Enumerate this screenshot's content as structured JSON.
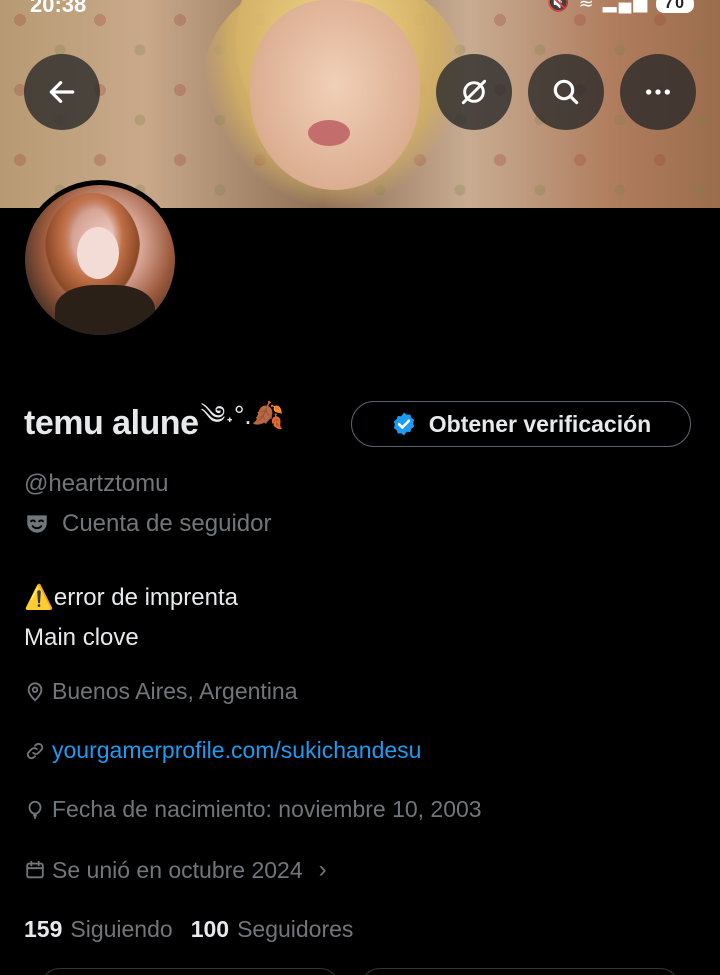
{
  "status_bar": {
    "time": "20:38",
    "battery": "70"
  },
  "header": {
    "buttons": [
      {
        "icon": "back-arrow-icon"
      },
      {
        "icon": "grok-icon"
      },
      {
        "icon": "search-icon"
      },
      {
        "icon": "more-icon"
      }
    ]
  },
  "profile": {
    "display_name": "temu alune",
    "name_decoration": "༄˖°.🍂",
    "verify_label": "Obtener verificación",
    "handle": "@heartztomu",
    "parody_label": "Cuenta de seguidor",
    "bio_line1": "⚠️error de imprenta",
    "bio_line2": "Main clove",
    "location": "Buenos Aires, Argentina",
    "link": "yourgamerprofile.com/sukichandesu",
    "birth": "Fecha de nacimiento: noviembre 10, 2003",
    "joined": "Se unió en octubre 2024",
    "following_count": "159",
    "following_label": "Siguiendo",
    "followers_count": "100",
    "followers_label": "Seguidores"
  },
  "colors": {
    "background": "#000000",
    "primary_text": "#e7e9ea",
    "secondary_text": "#71767b",
    "link": "#1d9bf0",
    "verify_badge": "#1d9bf0"
  }
}
